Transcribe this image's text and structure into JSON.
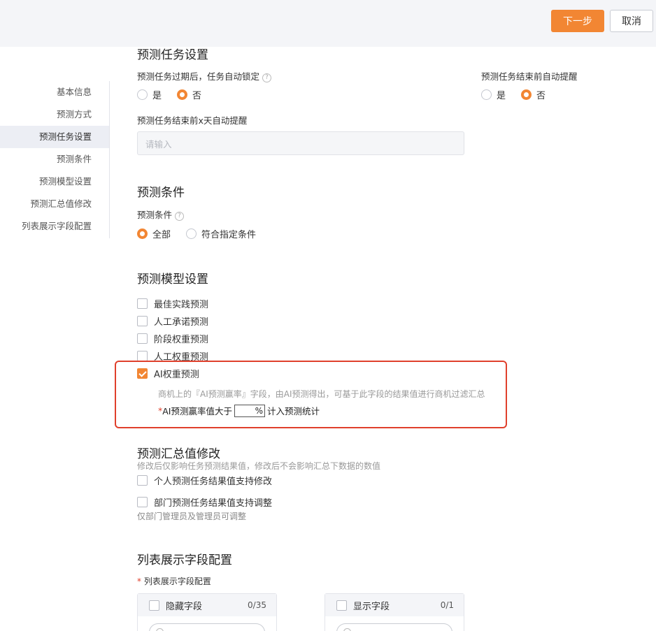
{
  "header": {
    "next_label": "下一步",
    "cancel_label": "取消"
  },
  "sidebar": {
    "items": [
      {
        "label": "基本信息",
        "active": false
      },
      {
        "label": "预测方式",
        "active": false
      },
      {
        "label": "预测任务设置",
        "active": true
      },
      {
        "label": "预测条件",
        "active": false
      },
      {
        "label": "预测模型设置",
        "active": false
      },
      {
        "label": "预测汇总值修改",
        "active": false
      },
      {
        "label": "列表展示字段配置",
        "active": false
      }
    ]
  },
  "task_settings": {
    "title": "预测任务设置",
    "auto_lock_label": "预测任务过期后，任务自动锁定",
    "auto_lock_options": [
      "是",
      "否"
    ],
    "auto_lock_selected": "否",
    "remind_label": "预测任务结束前自动提醒",
    "remind_options": [
      "是",
      "否"
    ],
    "remind_selected": "否",
    "remind_days_label": "预测任务结束前x天自动提醒",
    "remind_days_placeholder": "请输入"
  },
  "conditions": {
    "title": "预测条件",
    "label": "预测条件",
    "options": [
      "全部",
      "符合指定条件"
    ],
    "selected": "全部"
  },
  "models": {
    "title": "预测模型设置",
    "items": [
      {
        "label": "最佳实践预测",
        "checked": false
      },
      {
        "label": "人工承诺预测",
        "checked": false
      },
      {
        "label": "阶段权重预测",
        "checked": false
      },
      {
        "label": "人工权重预测",
        "checked": false
      },
      {
        "label": "AI权重预测",
        "checked": true
      }
    ],
    "ai_description": "商机上的『AI预测赢率』字段，由AI预测得出，可基于此字段的结果值进行商机过滤汇总",
    "ai_threshold_required_mark": "*",
    "ai_threshold_prefix": "AI预测赢率值大于",
    "ai_threshold_unit": "%",
    "ai_threshold_suffix": "计入预测统计"
  },
  "summary_edit": {
    "title": "预测汇总值修改",
    "note": "修改后仅影响任务预测结果值，修改后不会影响汇总下数据的数值",
    "personal_label": "个人预测任务结果值支持修改",
    "department_label": "部门预测任务结果值支持调整",
    "department_note": "仅部门管理员及管理员可调整"
  },
  "list_fields": {
    "title": "列表展示字段配置",
    "required_mark": "*",
    "label": "列表展示字段配置",
    "hidden_panel": {
      "title": "隐藏字段",
      "count": "0/35"
    },
    "shown_panel": {
      "title": "显示字段",
      "count": "0/1"
    }
  },
  "colors": {
    "accent": "#f28633",
    "highlight_border": "#e0402c"
  },
  "icons": [
    "help-icon",
    "search-icon",
    "check-icon"
  ]
}
